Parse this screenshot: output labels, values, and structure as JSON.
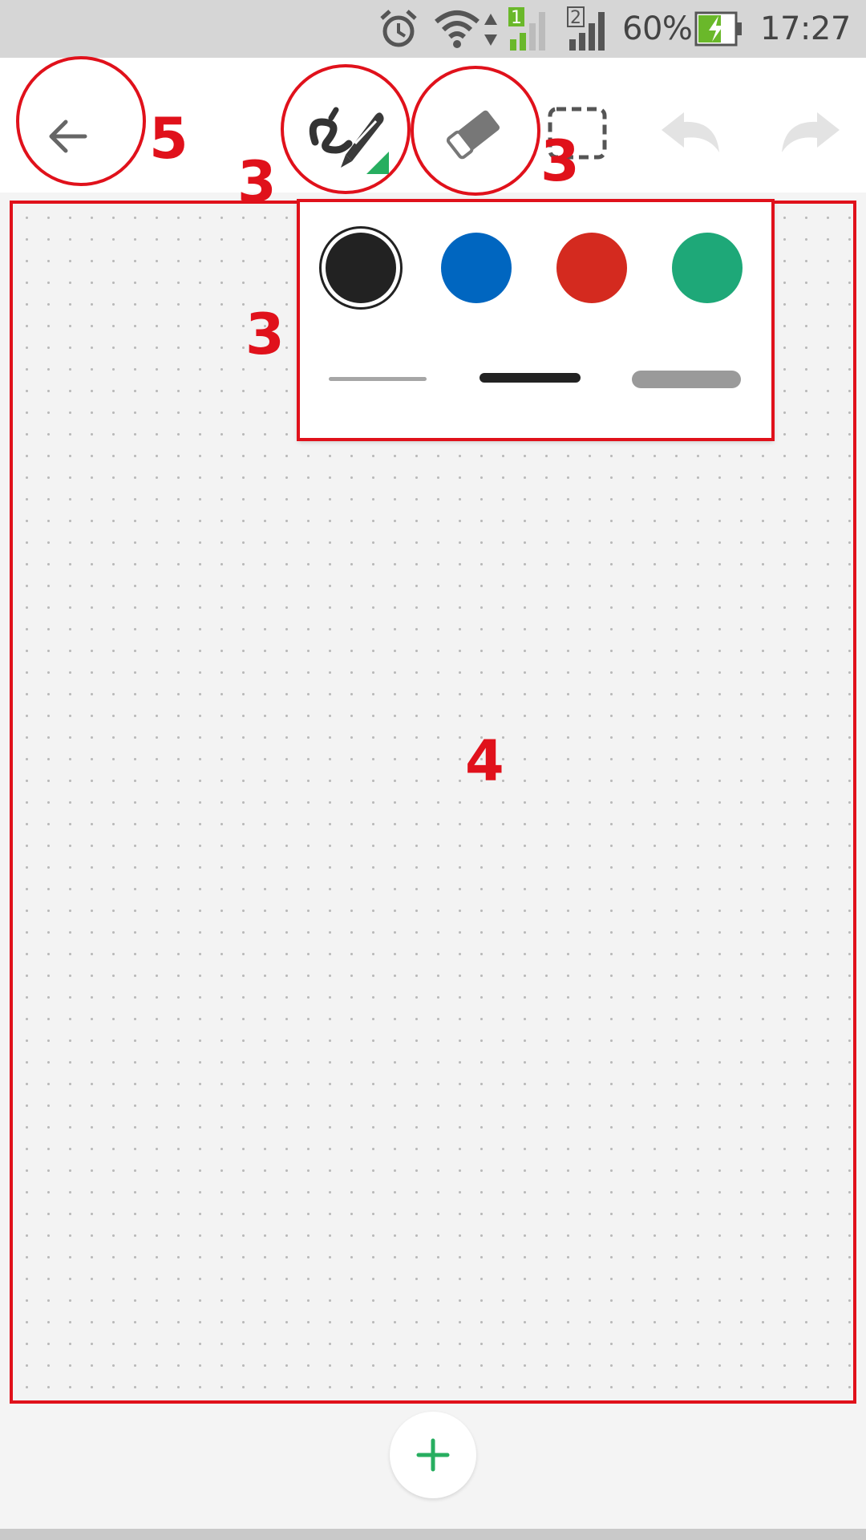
{
  "status_bar": {
    "time": "17:27",
    "battery_percent": "60%",
    "sim1_label": "1",
    "sim2_label": "2",
    "icons": [
      "alarm-icon",
      "wifi-icon",
      "data-arrows-icon",
      "signal-sim1-icon",
      "signal-sim2-icon",
      "battery-charging-icon"
    ]
  },
  "toolbar": {
    "buttons": [
      "back-icon",
      "pen-icon",
      "eraser-icon",
      "lasso-select-icon",
      "undo-icon",
      "redo-icon"
    ]
  },
  "pen_options": {
    "colors": [
      "#222222",
      "#0066c0",
      "#d42a1f",
      "#1ea878"
    ],
    "selected_color": "#222222",
    "stroke_widths": [
      "thin",
      "medium",
      "thick"
    ],
    "stroke_colors": [
      "#a6a6a6",
      "#222222",
      "#9a9a9a"
    ]
  },
  "annotations": {
    "back": "5",
    "pen": "3",
    "eraser": "3",
    "popup": "3",
    "canvas": "4"
  },
  "add_button": {
    "icon": "plus-icon",
    "color": "#27ae60"
  }
}
